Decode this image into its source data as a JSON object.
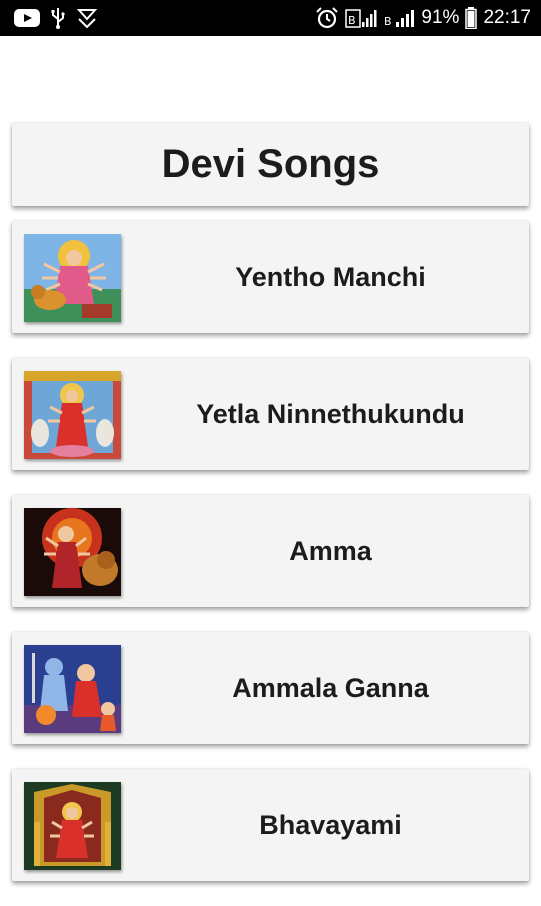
{
  "status_bar": {
    "icons_left": [
      "youtube-icon",
      "usb-icon",
      "download-icon"
    ],
    "icons_right": [
      "alarm-icon",
      "signal-icon",
      "signal-icon",
      "battery-icon"
    ],
    "battery_percent": "91%",
    "time": "22:17"
  },
  "header": {
    "title": "Devi Songs"
  },
  "songs": [
    {
      "title": "Yentho Manchi",
      "thumbnail": "goddess-durga-image"
    },
    {
      "title": "Yetla Ninnethukundu",
      "thumbnail": "goddess-lakshmi-image"
    },
    {
      "title": "Amma",
      "thumbnail": "goddess-durga-lion-image"
    },
    {
      "title": "Ammala Ganna",
      "thumbnail": "shiva-parvati-family-image"
    },
    {
      "title": "Bhavayami",
      "thumbnail": "goddess-temple-image"
    }
  ],
  "colors": {
    "status_bar_bg": "#000000",
    "card_bg": "#f4f4f4",
    "text": "#1c1c1c"
  }
}
